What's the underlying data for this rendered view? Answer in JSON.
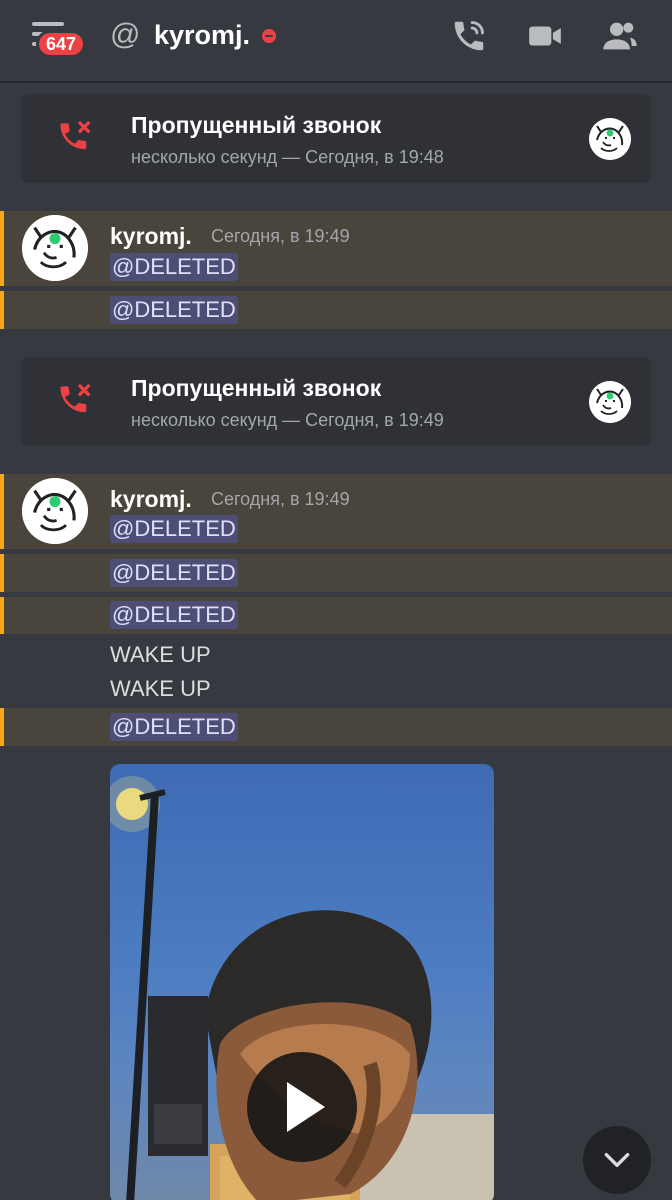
{
  "header": {
    "badge_count": "647",
    "at_symbol": "@",
    "username": "kyromj.",
    "status_color": "#ed4245",
    "icons": [
      "menu-icon",
      "at-icon",
      "phone-call-icon",
      "video-camera-icon",
      "members-icon"
    ]
  },
  "calls": [
    {
      "title": "Пропущенный звонок",
      "subtitle": "несколько секунд — Сегодня, в 19:48"
    },
    {
      "title": "Пропущенный звонок",
      "subtitle": "несколько секунд — Сегодня, в 19:49"
    }
  ],
  "messages": {
    "group1": {
      "author": "kyromj.",
      "timestamp": "Сегодня, в 19:49",
      "lines": [
        "@DELETED",
        "@DELETED"
      ]
    },
    "group2": {
      "author": "kyromj.",
      "timestamp": "Сегодня, в 19:49",
      "lines": [
        "@DELETED",
        "@DELETED",
        "@DELETED",
        "WAKE UP",
        "WAKE UP",
        "@DELETED"
      ]
    }
  },
  "colors": {
    "mention_highlight": "#49443c",
    "mention_bar": "#faa61a",
    "missed_call_red": "#ed4245",
    "background": "#36393f"
  }
}
